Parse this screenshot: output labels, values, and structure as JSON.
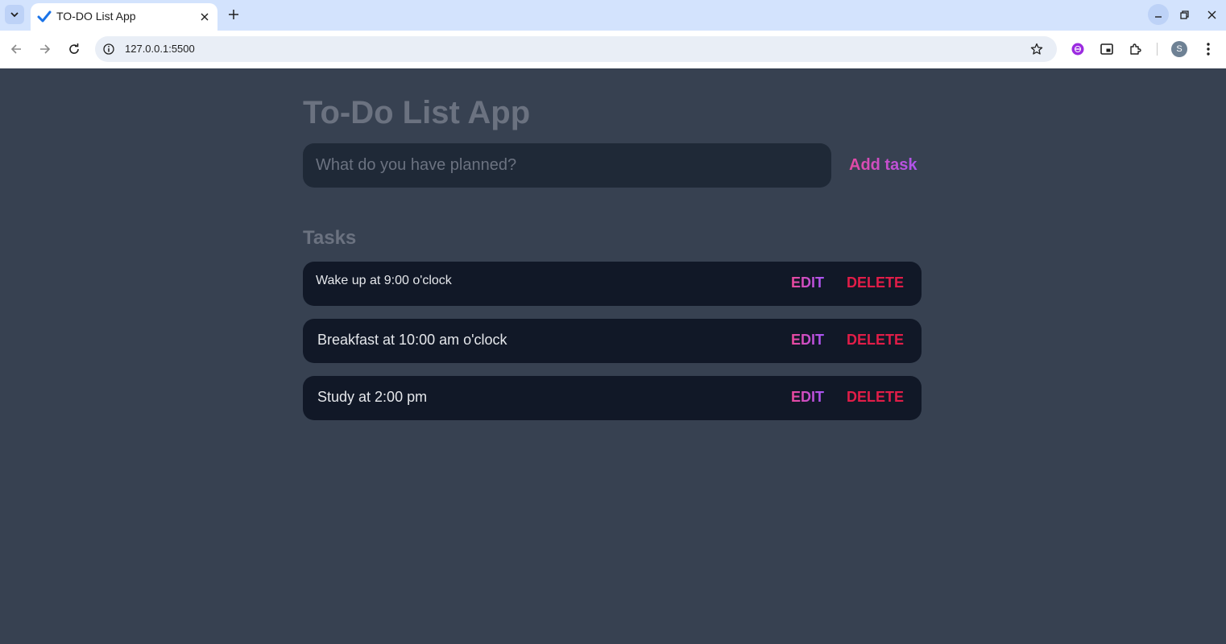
{
  "browser": {
    "tab_title": "TO-DO List App",
    "url": "127.0.0.1:5500",
    "profile_initial": "S",
    "icons": [
      "tab-search-icon",
      "favicon-check-icon",
      "close-icon",
      "plus-icon",
      "minimize-icon",
      "restore-icon",
      "window-close-icon",
      "back-arrow-icon",
      "forward-arrow-icon",
      "reload-icon",
      "info-icon",
      "star-icon",
      "extension-icon",
      "picture-in-picture-icon",
      "puzzle-icon",
      "kebab-menu-icon"
    ]
  },
  "app": {
    "title": "To-Do List App",
    "input_placeholder": "What do you have planned?",
    "add_button": "Add task",
    "tasks_heading": "Tasks",
    "edit_label": "EDIT",
    "delete_label": "DELETE",
    "tasks": [
      {
        "text": "Wake up at 9:00 o'clock"
      },
      {
        "text": "Breakfast at 10:00 am o'clock"
      },
      {
        "text": "Study at 2:00 pm"
      }
    ]
  },
  "colors": {
    "page_bg": "#374151",
    "input_bg": "#1f2937",
    "task_bg": "#111827",
    "accent_pink": "#ec4899",
    "accent_purple": "#a855f7",
    "delete_red": "#e11d48"
  }
}
